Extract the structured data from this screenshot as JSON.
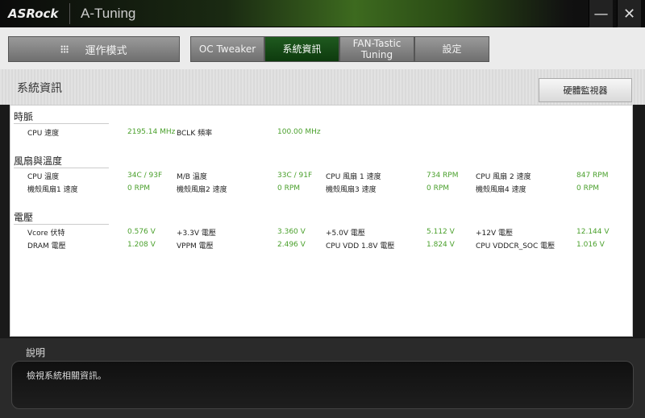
{
  "window": {
    "logo": "ASRock",
    "title": "A-Tuning",
    "minimize_label": "—",
    "close_label": "✕"
  },
  "mode_button": {
    "label": "運作模式",
    "icon": "grid-icon"
  },
  "tabs": [
    {
      "label": "OC Tweaker",
      "active": false
    },
    {
      "label": "系統資訊",
      "active": true
    },
    {
      "label_line1": "FAN-Tastic",
      "label_line2": "Tuning",
      "active": false
    },
    {
      "label": "設定",
      "active": false
    }
  ],
  "page": {
    "title": "系統資訊",
    "hw_monitor_button": "硬體監視器"
  },
  "clock": {
    "title": "時脈",
    "cpu_speed_label": "CPU 速度",
    "cpu_speed_value": "2195.14 MHz",
    "bclk_label": "BCLK 頻率",
    "bclk_value": "100.00 MHz"
  },
  "fans_temps": {
    "title": "風扇與溫度",
    "cpu_temp_label": "CPU 溫度",
    "cpu_temp_value": "34C / 93F",
    "mb_temp_label": "M/B 溫度",
    "mb_temp_value": "33C / 91F",
    "cpu_fan1_label": "CPU 風扇 1 速度",
    "cpu_fan1_value": "734 RPM",
    "cpu_fan2_label": "CPU 風扇 2 速度",
    "cpu_fan2_value": "847 RPM",
    "chassis_fan1_label": "機殼風扇1 速度",
    "chassis_fan1_value": "0 RPM",
    "chassis_fan2_label": "機殼風扇2 速度",
    "chassis_fan2_value": "0 RPM",
    "chassis_fan3_label": "機殼風扇3 速度",
    "chassis_fan3_value": "0 RPM",
    "chassis_fan4_label": "機殼風扇4 速度",
    "chassis_fan4_value": "0 RPM"
  },
  "voltage": {
    "title": "電壓",
    "vcore_label": "Vcore 伏特",
    "vcore_value": "0.576 V",
    "v33_label": "+3.3V 電壓",
    "v33_value": "3.360 V",
    "v50_label": "+5.0V 電壓",
    "v50_value": "5.112 V",
    "v12_label": "+12V 電壓",
    "v12_value": "12.144 V",
    "dram_label": "DRAM 電壓",
    "dram_value": "1.208 V",
    "vppm_label": "VPPM 電壓",
    "vppm_value": "2.496 V",
    "cpuvdd_label": "CPU VDD 1.8V 電壓",
    "cpuvdd_value": "1.824 V",
    "vddcr_label": "CPU VDDCR_SOC 電壓",
    "vddcr_value": "1.016 V"
  },
  "help": {
    "title": "說明",
    "text": "檢視系統相關資訊。"
  },
  "colors": {
    "value_green": "#4aa02c",
    "active_tab": "#0d3a0d"
  }
}
